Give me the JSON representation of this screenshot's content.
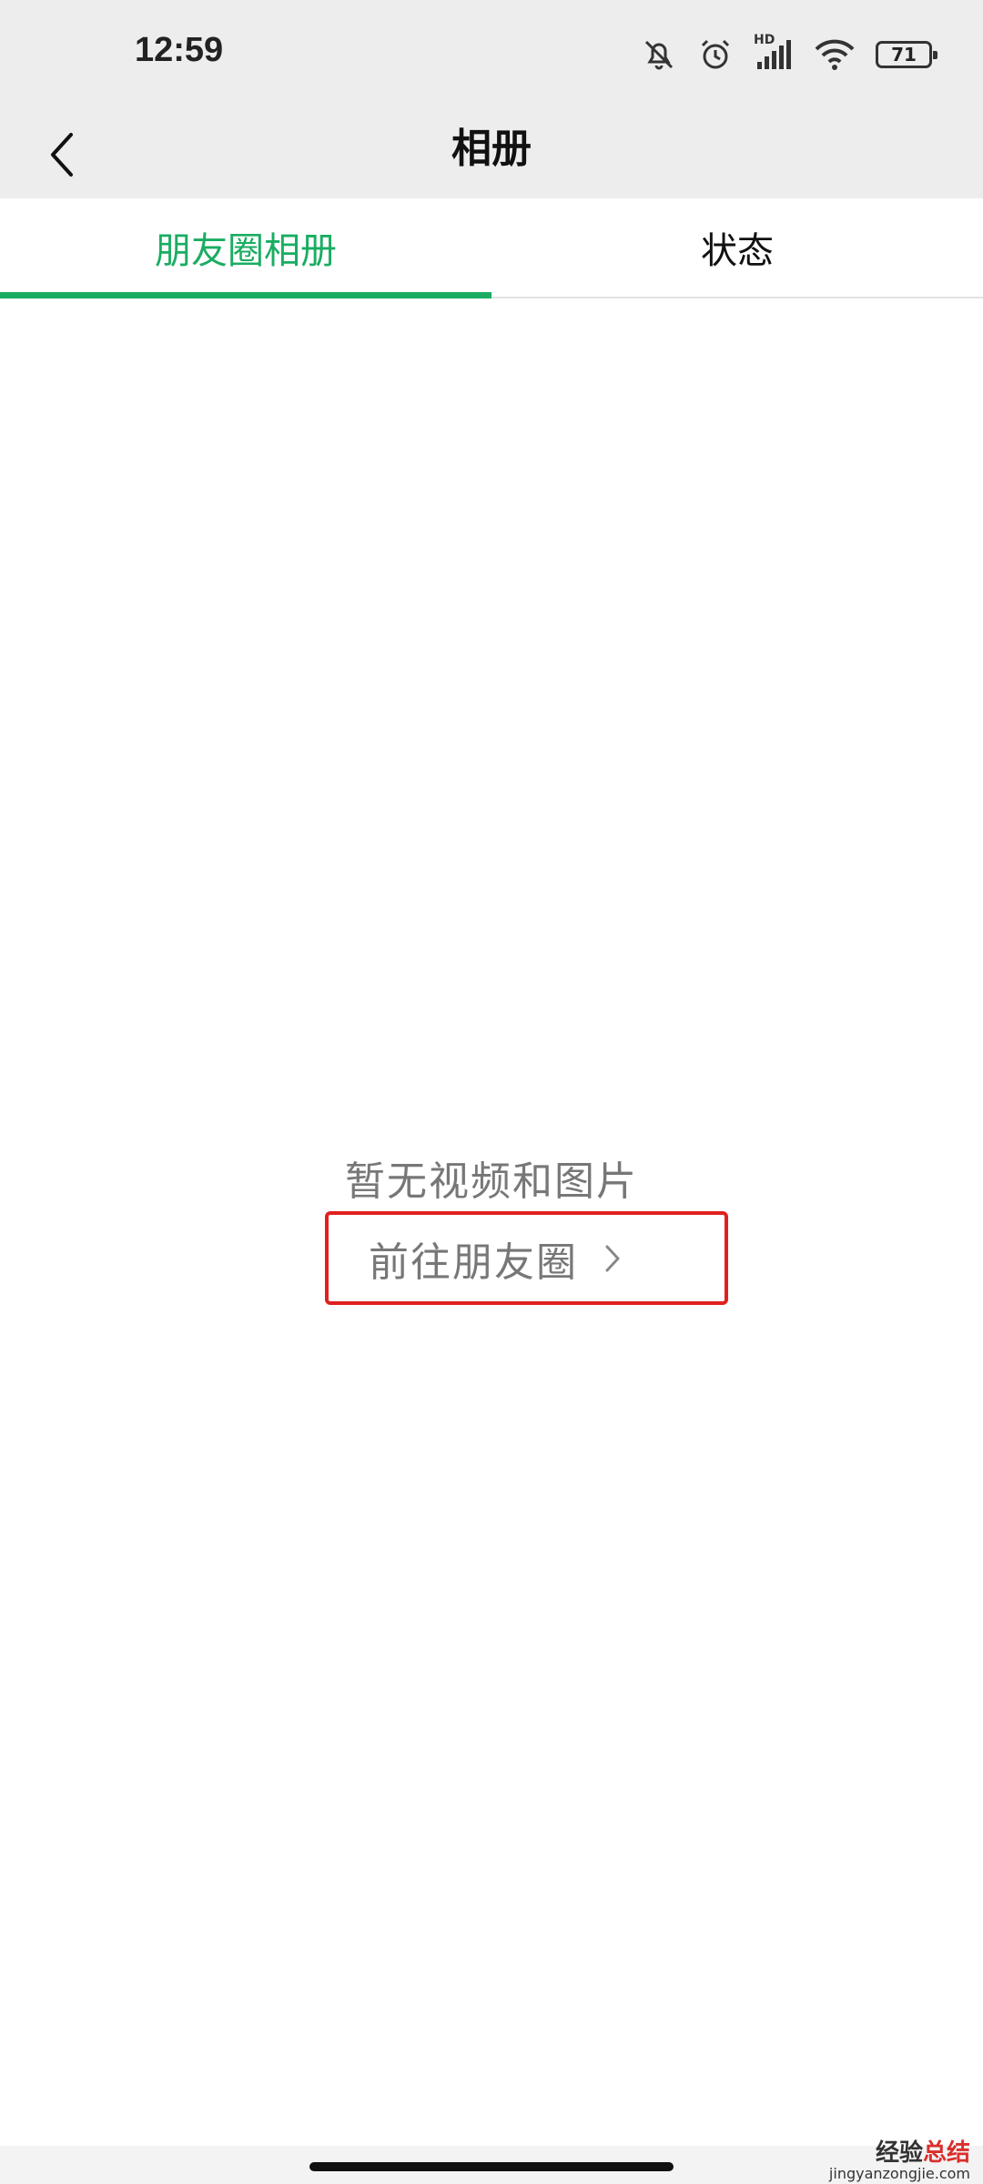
{
  "status_bar": {
    "time": "12:59",
    "network_label": "HD",
    "battery_level": "71"
  },
  "header": {
    "title": "相册"
  },
  "tabs": [
    {
      "label": "朋友圈相册",
      "active": true
    },
    {
      "label": "状态",
      "active": false
    }
  ],
  "empty_state": {
    "message": "暂无视频和图片",
    "link_label": "前往朋友圈"
  },
  "watermark": {
    "brand_part1": "经验",
    "brand_part2": "总结",
    "url": "jingyanzongjie.com"
  },
  "colors": {
    "accent": "#1aad62",
    "highlight_box": "#e02020",
    "header_bg": "#ededed"
  },
  "icons": {
    "back": "chevron-left-icon",
    "link": "chevron-right-icon"
  }
}
